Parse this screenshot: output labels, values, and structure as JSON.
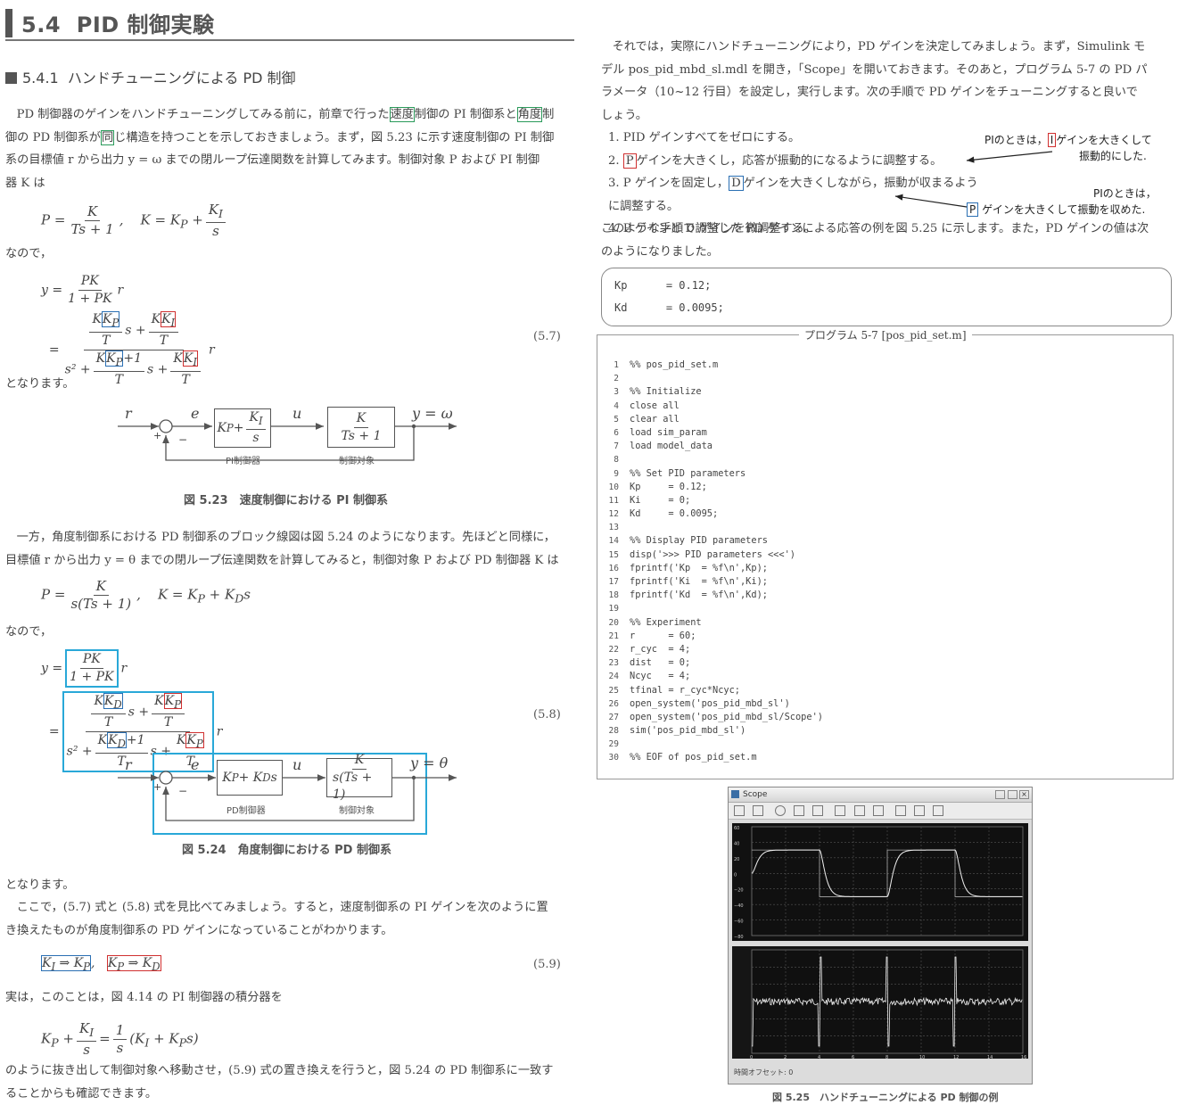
{
  "section": {
    "number": "5.4",
    "title": "PID 制御実験"
  },
  "subsection": {
    "number": "5.4.1",
    "title": "ハンドチューニングによる PD 制御"
  },
  "left": {
    "intro": [
      "PD 制御器のゲインをハンドチューニングしてみる前に，前章で行った",
      "速度",
      "制御の PI 制御系と",
      "角度",
      "制",
      "御の PD 制御系が",
      "同",
      "じ構造を持つことを示しておきましょう。まず，図 5.23 に示す速度制御の PI 制御",
      "系の目標値 r から出力 y = ω までの閉ループ伝達関数を計算してみます。制御対象 P および PI 制御",
      "器 K は"
    ],
    "eq_P1": "P = K / (Ts+1),   K = K_P + K_I / s",
    "nanode1": "なので，",
    "eq57_label": "(5.7)",
    "tonarimasu1": "となります。",
    "fig523": {
      "r": "r",
      "e": "e",
      "u": "u",
      "y": "y = ω",
      "block1_label": "PI制御器",
      "block2_label": "制御対象",
      "plus": "+",
      "minus": "−",
      "caption": "図 5.23　速度制御における PI 制御系"
    },
    "para2": [
      "一方，角度制御系における PD 制御系のブロック線図は図 5.24 のようになります。先ほどと同様に，",
      "目標値 r から出力 y = θ までの閉ループ伝達関数を計算してみると，制御対象 P および PD 制御器 K は"
    ],
    "nanode2": "なので，",
    "eq58_label": "(5.8)",
    "fig524": {
      "r": "r",
      "e": "e",
      "u": "u",
      "y": "y = θ",
      "block1_label": "PD制御器",
      "block2_label": "制御対象",
      "plus": "+",
      "minus": "−",
      "caption": "図 5.24　角度制御における PD 制御系"
    },
    "tonarimasu2": "となります。",
    "para3": [
      "ここで，(5.7) 式と (5.8) 式を見比べてみましょう。すると，速度制御系の PI ゲインを次のように置",
      "き換えたものが角度制御系の PD ゲインになっていることがわかります。"
    ],
    "eq59_label": "(5.9)",
    "para4": "実は，このことは，図 4.14 の PI 制御器の積分器を",
    "para5": [
      "のように抜き出して制御対象へ移動させ，(5.9) 式の置き換えを行うと，図 5.24 の PD 制御系に一致す",
      "ることからも確認できます。"
    ]
  },
  "right": {
    "para1": [
      "それでは，実際にハンドチューニングにより，PD ゲインを決定してみましょう。まず，Simulink モ",
      "デル pos_pid_mbd_sl.mdl を開き，「Scope」を開いておきます。そのあと，プログラム 5-7 の PD パ",
      "ラメータ（10~12 行目）を設定し，実行します。次の手順で PD ゲインをチューニングすると良いで",
      "しょう。"
    ],
    "steps": [
      {
        "pre": "1.  PID ゲインすべてをゼロにする。",
        "box": "",
        "post": ""
      },
      {
        "pre": "2. ",
        "box": "P",
        "post": "ゲインを大きくし，応答が振動的になるように調整する。"
      },
      {
        "pre": "3.  P ゲインを固定し，",
        "box": "D",
        "post": "ゲインを大きくしながら，振動が収まるように調整する。"
      },
      {
        "pre": "4.  P ゲインと D ゲインを微調整する。",
        "box": "",
        "post": ""
      }
    ],
    "note1": {
      "a": "PIのときは，",
      "box": "I",
      "b": "ゲインを大きくして",
      "c": "振動的にした."
    },
    "note2": {
      "a": "PIのときは，",
      "box": "P",
      "b": " ゲインを大きくして振動を収めた."
    },
    "para2": [
      "このような手順で調整した PD ゲインによる応答の例を図 5.25 に示します。また，PD ゲインの値は次",
      "のようになりました。"
    ],
    "gains": [
      {
        "name": "Kp",
        "value": "= 0.12;"
      },
      {
        "name": "Kd",
        "value": "= 0.0095;"
      }
    ],
    "program": {
      "title": "プログラム 5-7 [pos_pid_set.m]",
      "lines": [
        "%% pos_pid_set.m",
        "",
        "%% Initialize",
        "close all",
        "clear all",
        "load sim_param",
        "load model_data",
        "",
        "%% Set PID parameters",
        "Kp     = 0.12;",
        "Ki     = 0;",
        "Kd     = 0.0095;",
        "",
        "%% Display PID parameters",
        "disp('>>> PID parameters <<<')",
        "fprintf('Kp  = %f\\n',Kp);",
        "fprintf('Ki  = %f\\n',Ki);",
        "fprintf('Kd  = %f\\n',Kd);",
        "",
        "%% Experiment",
        "r      = 60;",
        "r_cyc  = 4;",
        "dist   = 0;",
        "Ncyc   = 4;",
        "tfinal = r_cyc*Ncyc;",
        "open_system('pos_pid_mbd_sl')",
        "open_system('pos_pid_mbd_sl/Scope')",
        "sim('pos_pid_mbd_sl')",
        "",
        "%% EOF of pos_pid_set.m"
      ]
    },
    "scope": {
      "window_title": "Scope",
      "yticks_top": [
        "60",
        "40",
        "20",
        "0",
        "−20",
        "−40",
        "−60",
        "−80"
      ],
      "xticks": [
        "0",
        "2",
        "4",
        "6",
        "8",
        "10",
        "12",
        "14",
        "16"
      ],
      "status": "時間オフセット: 0",
      "caption": "図 5.25　ハンドチューニングによる PD 制御の例"
    }
  }
}
